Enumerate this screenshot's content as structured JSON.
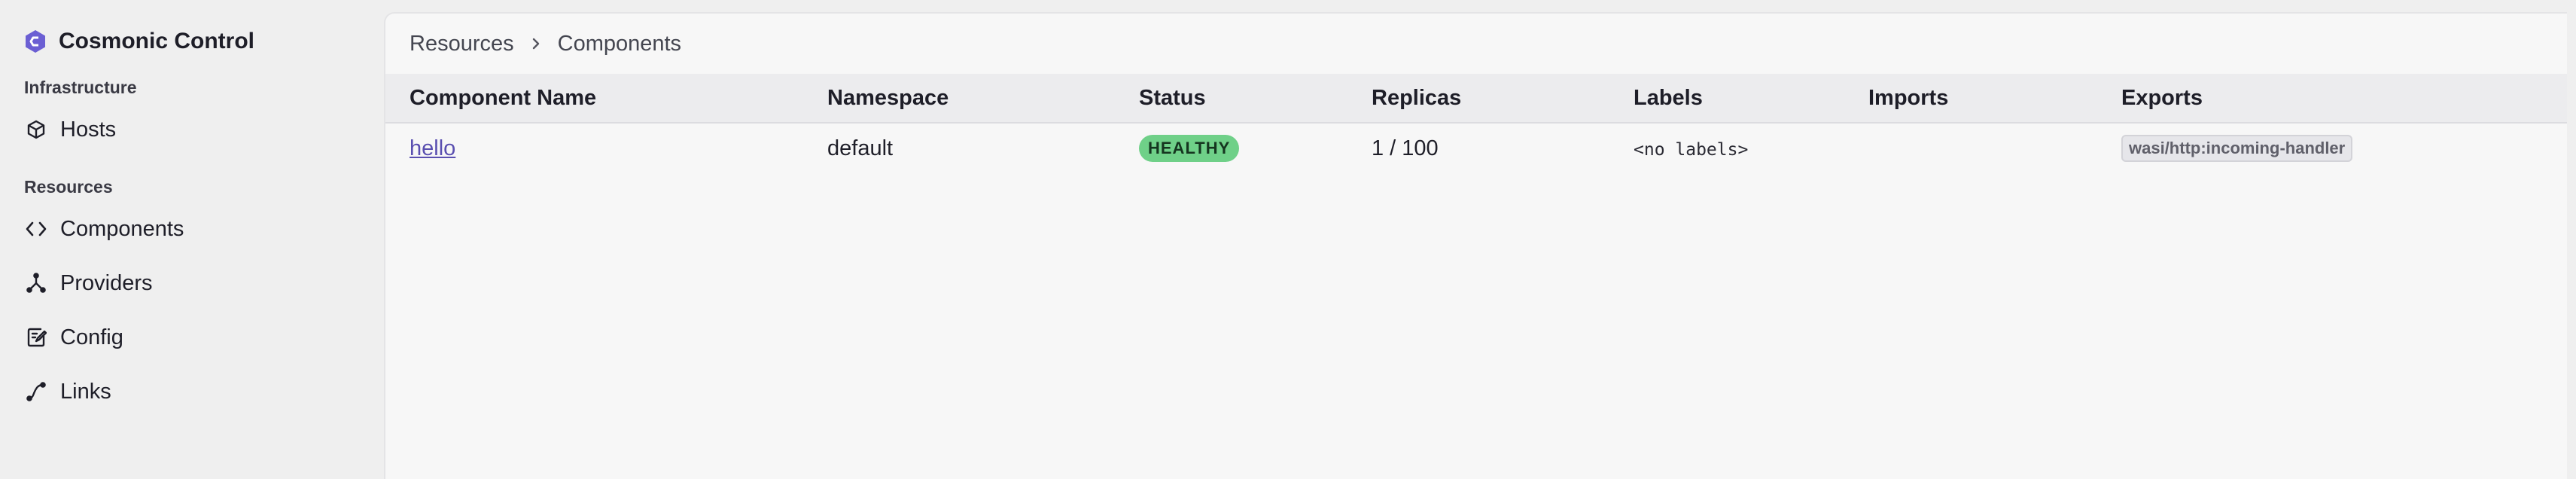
{
  "app": {
    "brand_name": "Cosmonic Control",
    "accent_color": "#6b5fd3"
  },
  "sidebar": {
    "sections": [
      {
        "label": "Infrastructure",
        "items": [
          {
            "label": "Hosts",
            "icon": "cube-icon"
          }
        ]
      },
      {
        "label": "Resources",
        "items": [
          {
            "label": "Components",
            "icon": "code-brackets-icon"
          },
          {
            "label": "Providers",
            "icon": "branch-icon"
          },
          {
            "label": "Config",
            "icon": "document-edit-icon"
          },
          {
            "label": "Links",
            "icon": "link-curve-icon"
          }
        ]
      }
    ]
  },
  "breadcrumb": {
    "items": [
      "Resources",
      "Components"
    ],
    "separator_icon": "chevron-right-icon"
  },
  "table": {
    "columns": [
      "Component Name",
      "Namespace",
      "Status",
      "Replicas",
      "Labels",
      "Imports",
      "Exports"
    ],
    "rows": [
      {
        "name": "hello",
        "namespace": "default",
        "status": "HEALTHY",
        "status_color": "#6fd088",
        "replicas": "1 / 100",
        "labels": "<no labels>",
        "imports": "",
        "exports": [
          "wasi/http:incoming-handler"
        ]
      }
    ]
  }
}
